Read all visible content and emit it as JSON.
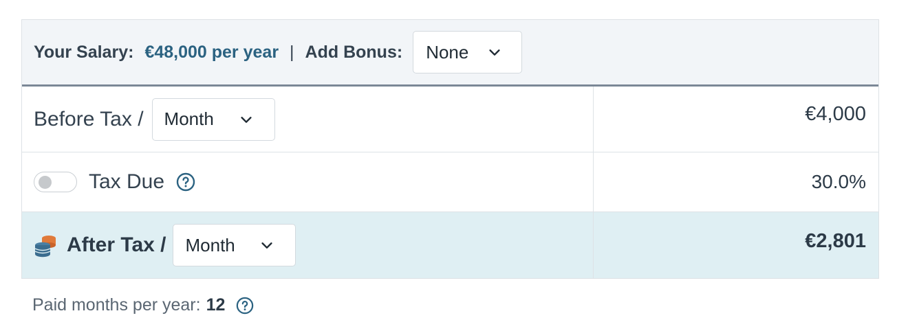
{
  "header": {
    "salary_label": "Your Salary:",
    "salary_value": "€48,000 per year",
    "separator": "|",
    "bonus_label": "Add Bonus:",
    "bonus_selected": "None"
  },
  "rows": {
    "before_tax": {
      "label": "Before Tax /",
      "period": "Month",
      "value": "€4,000"
    },
    "tax_due": {
      "label": "Tax Due",
      "toggle_on": false,
      "value": "30.0%"
    },
    "after_tax": {
      "label": "After Tax /",
      "period": "Month",
      "value": "€2,801"
    }
  },
  "footer": {
    "label": "Paid months per year:",
    "value": "12"
  },
  "colors": {
    "accent": "#2b6281",
    "header_bg": "#f2f5f8",
    "highlight_bg": "#dfeff3",
    "coin_orange": "#e07a3a",
    "coin_blue": "#3b6d8f"
  },
  "icons": [
    "chevron-down-icon",
    "help-icon",
    "coins-icon",
    "toggle-switch"
  ]
}
